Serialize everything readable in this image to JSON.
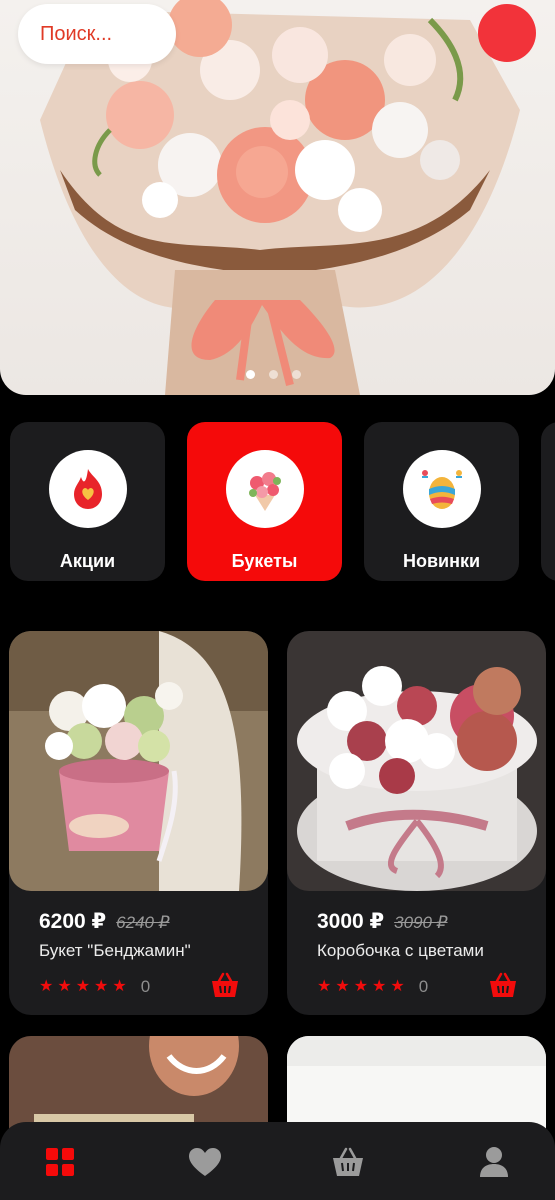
{
  "search": {
    "placeholder": "Поиск..."
  },
  "hero": {
    "slides": 3,
    "active_slide": 1
  },
  "categories": [
    {
      "label": "Акции",
      "icon": "flame-heart-icon",
      "active": false
    },
    {
      "label": "Букеты",
      "icon": "bouquet-icon",
      "active": true
    },
    {
      "label": "Новинки",
      "icon": "gift-egg-icon",
      "active": false
    }
  ],
  "products": [
    {
      "price": "6200 ₽",
      "old_price": "6240 ₽",
      "name": "Букет \"Бенджамин\"",
      "rating_count": "0",
      "stars": 5
    },
    {
      "price": "3000 ₽",
      "old_price": "3090 ₽",
      "name": "Коробочка с цветами",
      "rating_count": "0",
      "stars": 5
    }
  ],
  "tabbar": {
    "items": [
      "catalog-icon",
      "heart-icon",
      "basket-icon",
      "profile-icon"
    ],
    "active": "catalog-icon"
  },
  "colors": {
    "accent": "#f50a0a",
    "card": "#1c1c1e",
    "background": "#000000"
  }
}
